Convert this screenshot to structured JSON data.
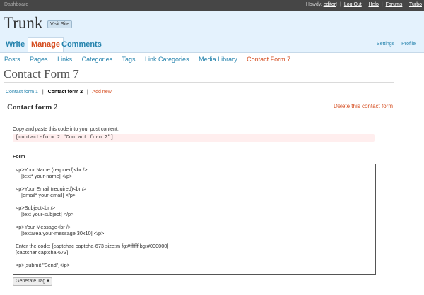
{
  "topbar": {
    "dashboard_label": "Dashboard",
    "howdy": "Howdy,",
    "user": "editor",
    "howdy_end": "!",
    "links": [
      "Log Out",
      "Help",
      "Forums",
      "Turbo"
    ]
  },
  "header": {
    "site_title": "Trunk",
    "visit_site_label": "Visit Site",
    "tabs": [
      "Write",
      "Manage",
      "Comments"
    ],
    "active_tab": "Manage",
    "right_links": [
      "Settings",
      "Profile"
    ]
  },
  "submenu": {
    "items": [
      "Posts",
      "Pages",
      "Links",
      "Categories",
      "Tags",
      "Link Categories",
      "Media Library",
      "Contact Form 7"
    ],
    "current": "Contact Form 7"
  },
  "page": {
    "title": "Contact Form 7"
  },
  "form_nav": {
    "forms": [
      "Contact form 1",
      "Contact form 2"
    ],
    "current": "Contact form 2",
    "add_new_label": "Add new"
  },
  "form": {
    "heading": "Contact form 2",
    "delete_label": "Delete this contact form",
    "copy_instruction": "Copy and paste this code into your post content.",
    "shortcode": "[contact-form 2 \"Contact form 2\"]",
    "form_label": "Form",
    "code": "<p>Your Name (required)<br />\n    [text* your-name] </p>\n\n<p>Your Email (required)<br />\n    [email* your-email] </p>\n\n<p>Subject<br />\n    [text your-subject] </p>\n\n<p>Your Message<br />\n    [textarea your-message 30x10] </p>\n\nEnter the code: [captchac captcha-673 size:m fg:#ffffff bg:#000000]\n[captchar captcha-673]\n\n<p>[submit \"Send\"]</p>",
    "generate_tag_label": "Generate Tag",
    "generate_tag_arrow": "▾"
  },
  "colors": {
    "accent_blue": "#2583ad",
    "accent_orange": "#d54e21",
    "header_bg": "#e4f2fd",
    "topbar_bg": "#464646"
  }
}
